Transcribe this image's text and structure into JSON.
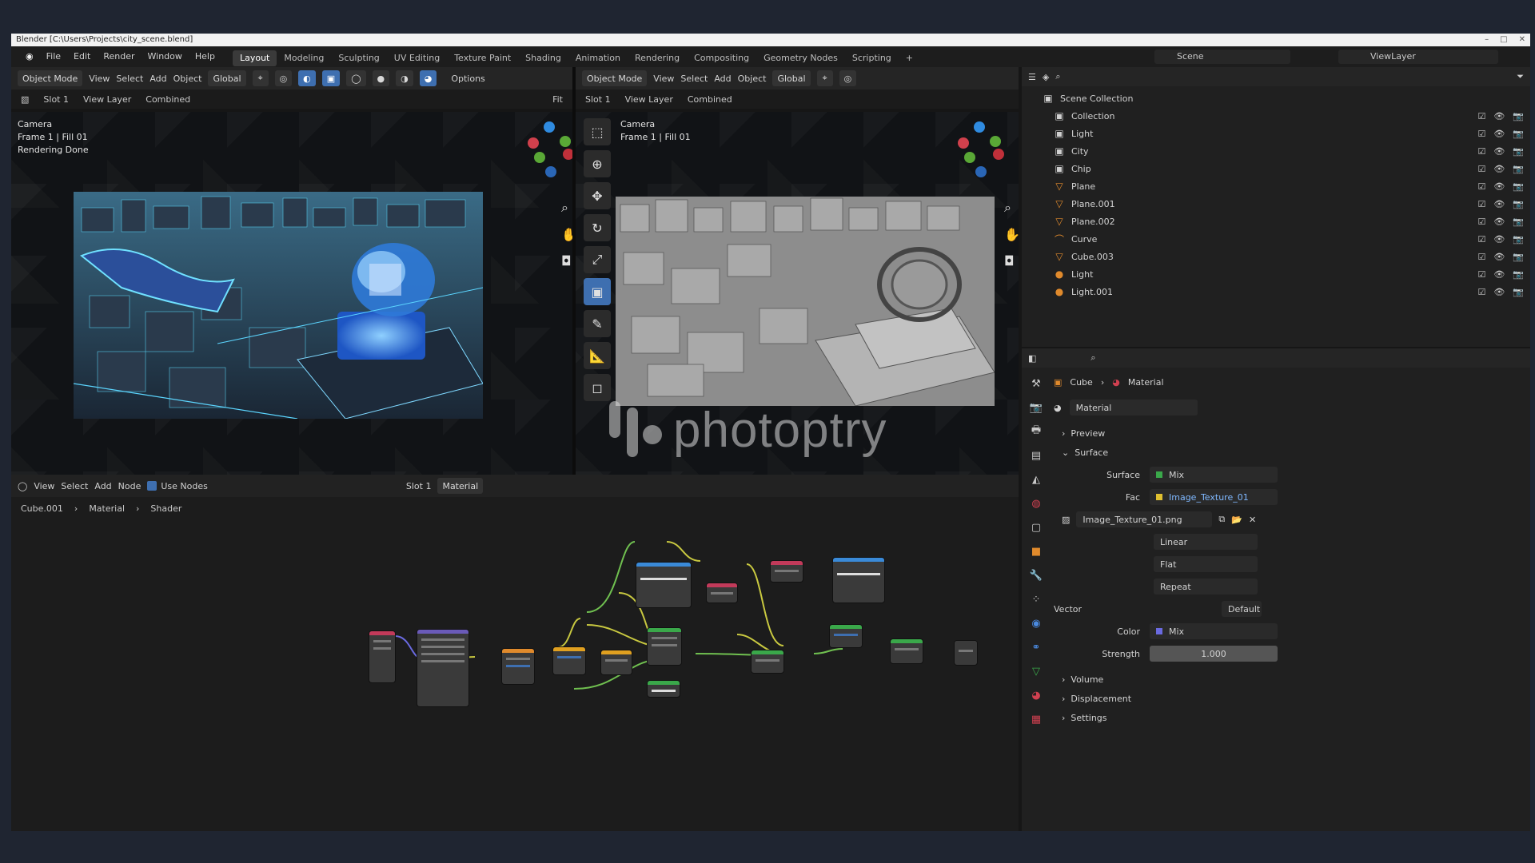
{
  "window": {
    "title": "Blender [C:\\Users\\Projects\\city_scene.blend]",
    "controls": [
      "–",
      "□",
      "✕"
    ]
  },
  "menubar": {
    "menus": [
      "File",
      "Edit",
      "Render",
      "Window",
      "Help"
    ],
    "workspaces": [
      "Layout",
      "Modeling",
      "Sculpting",
      "UV Editing",
      "Texture Paint",
      "Shading",
      "Animation",
      "Rendering",
      "Compositing",
      "Geometry Nodes",
      "Scripting"
    ],
    "add_tab": "+",
    "scene": "Scene",
    "view_layer": "ViewLayer"
  },
  "left_view": {
    "header": {
      "mode": "Object Mode",
      "menus": [
        "View",
        "Select",
        "Add",
        "Object"
      ],
      "orientation": "Global",
      "option": "Options"
    },
    "subheader": {
      "slot": "Slot 1",
      "layer": "View Layer",
      "pass": "Combined",
      "zoom": "Fit"
    },
    "info": [
      "Camera",
      "Frame 1 | Fill 01",
      "Rendering Done"
    ]
  },
  "right_view": {
    "header": {
      "mode": "Object Mode",
      "menus": [
        "View",
        "Select",
        "Add",
        "Object"
      ],
      "orientation": "Global"
    },
    "subheader": {
      "slot": "Slot 1",
      "layer": "View Layer",
      "pass": "Combined"
    },
    "info": [
      "Camera",
      "Frame 1 | Fill 01"
    ]
  },
  "watermark": "photoptry",
  "node_editor": {
    "header": {
      "menus": [
        "View",
        "Select",
        "Add",
        "Node"
      ],
      "use_nodes": "Use Nodes",
      "slot": "Slot 1",
      "material": "Material"
    },
    "breadcrumb": [
      "Cube.001",
      "Material",
      "Shader"
    ]
  },
  "outliner": {
    "title": "Scene Collection",
    "rows": [
      {
        "label": "Collection",
        "icon": "collection-icon",
        "color": "#d0d0d0"
      },
      {
        "label": "Light",
        "icon": "collection-icon",
        "color": "#d0d0d0"
      },
      {
        "label": "City",
        "icon": "collection-icon",
        "color": "#d0d0d0"
      },
      {
        "label": "Chip",
        "icon": "collection-icon",
        "color": "#d0d0d0"
      },
      {
        "label": "Plane",
        "icon": "mesh-icon",
        "color": "#e08a2c"
      },
      {
        "label": "Plane.001",
        "icon": "mesh-icon",
        "color": "#e08a2c"
      },
      {
        "label": "Plane.002",
        "icon": "mesh-icon",
        "color": "#e08a2c"
      },
      {
        "label": "Curve",
        "icon": "curve-icon",
        "color": "#e08a2c"
      },
      {
        "label": "Cube.003",
        "icon": "mesh-icon",
        "color": "#e08a2c"
      },
      {
        "label": "Light",
        "icon": "light-icon",
        "color": "#e08a2c"
      },
      {
        "label": "Light.001",
        "icon": "light-icon",
        "color": "#e08a2c"
      }
    ]
  },
  "properties": {
    "breadcrumb": [
      "Cube",
      "Material"
    ],
    "material_name": "Material",
    "sections": {
      "preview": "Preview",
      "surface": "Surface",
      "surface_label": "Surface",
      "surface_value": "Mix",
      "fac_label": "Fac",
      "fac_value": "Image_Texture_01",
      "image_name": "Image_Texture_01.png",
      "opt1": "Linear",
      "opt2": "Flat",
      "opt3": "Repeat",
      "vector_label": "Vector",
      "vector_value": "Default",
      "color_label": "Color",
      "color_value": "Mix",
      "strength_label": "Strength",
      "strength_value": "1.000",
      "volume": "Volume",
      "displacement": "Displacement",
      "settings": "Settings"
    }
  }
}
